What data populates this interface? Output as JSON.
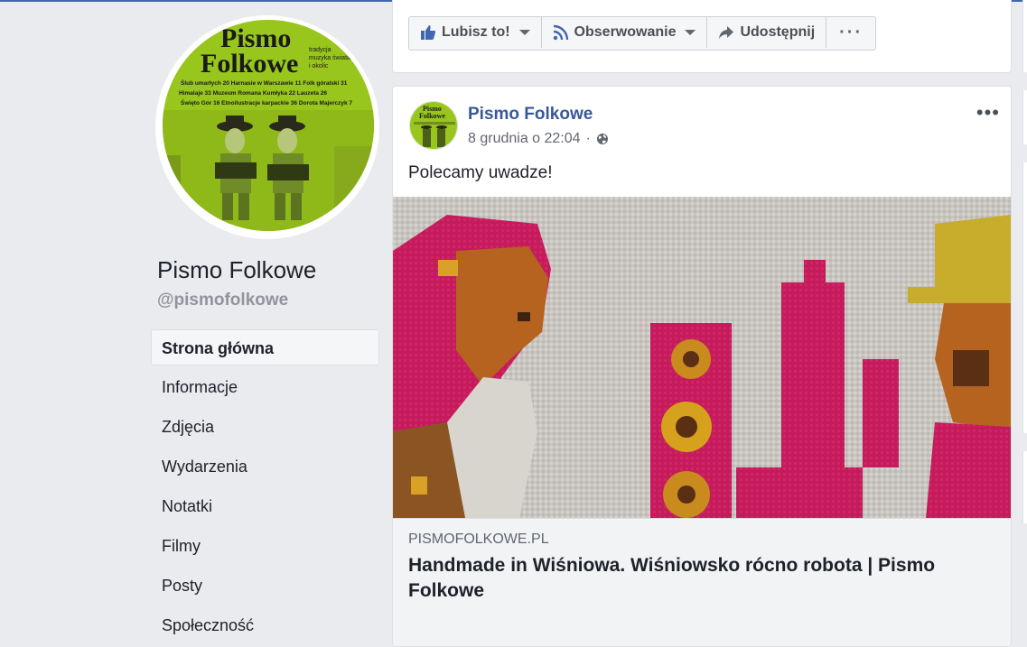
{
  "page": {
    "name": "Pismo Folkowe",
    "handle": "@pismofolkowe",
    "avatar_logo_line1": "Pismo",
    "avatar_logo_line2": "Folkowe",
    "avatar_tagline": "tradycja muzyka świata i okolic",
    "avatar_contents": [
      "Ślub umarłych 20",
      "Harnasie w Warszawie 11",
      "Folk góralski 31",
      "Himalaje 33",
      "Muzeum Romana Kumłyka 22",
      "Lauzeta 26",
      "Święto Gór 16",
      "Etnoilustracje karpackie 36",
      "Dorota Majerczyk 7"
    ],
    "accent_color": "#9ecc1a"
  },
  "nav": {
    "items": [
      {
        "label": "Strona główna",
        "active": true
      },
      {
        "label": "Informacje",
        "active": false
      },
      {
        "label": "Zdjęcia",
        "active": false
      },
      {
        "label": "Wydarzenia",
        "active": false
      },
      {
        "label": "Notatki",
        "active": false
      },
      {
        "label": "Filmy",
        "active": false
      },
      {
        "label": "Posty",
        "active": false
      },
      {
        "label": "Społeczność",
        "active": false
      }
    ]
  },
  "actions": {
    "like_label": "Lubisz to!",
    "follow_label": "Obserwowanie",
    "share_label": "Udostępnij",
    "more_label": "···"
  },
  "post": {
    "author": "Pismo Folkowe",
    "timestamp": "8 grudnia o 22:04",
    "separator": "·",
    "privacy_icon": "globe-icon",
    "menu_label": "•••",
    "text": "Polecamy uwadze!",
    "link": {
      "domain": "PISMOFOLKOWE.PL",
      "title": "Handmade in Wiśniowa. Wiśniowsko rócno robota | Pismo Folkowe"
    },
    "info_label": "i"
  },
  "colors": {
    "link_blue": "#385898",
    "background": "#e9ebee"
  }
}
